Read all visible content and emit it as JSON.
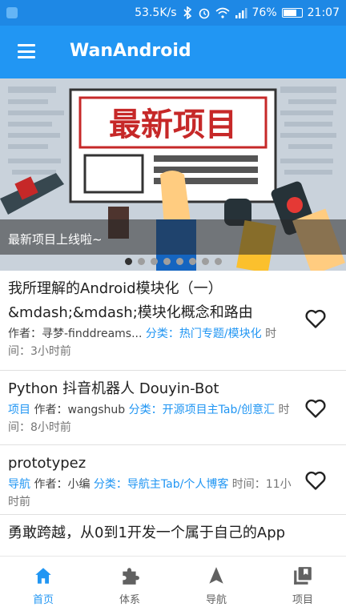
{
  "status_bar": {
    "net_speed": "53.5K/s",
    "battery": "76%",
    "battery_level": 0.76,
    "time": "21:07"
  },
  "toolbar": {
    "menu_icon": "menu-icon",
    "title": "WanAndroid"
  },
  "banner": {
    "image_text": "最新项目",
    "caption": "最新项目上线啦~",
    "dot_count": 8,
    "active_dot": 0
  },
  "articles": [
    {
      "title": "我所理解的Android模块化（一）&mdash;&mdash;模块化概念和路由",
      "author_label": "作者：",
      "author": "寻梦-finddreams...",
      "category_label": "分类：",
      "category": "热门专题/模块化",
      "time_label": "时间：",
      "time": "3小时前",
      "tag": ""
    },
    {
      "title": "Python 抖音机器人 Douyin-Bot",
      "tag": "项目",
      "author_label": "作者：",
      "author": "wangshub",
      "category_label": "分类：",
      "category": "开源项目主Tab/创意汇",
      "time_label": "时间：",
      "time": "8小时前"
    },
    {
      "title": "prototypez",
      "tag": "导航",
      "author_label": "作者：",
      "author": "小编",
      "category_label": "分类：",
      "category": "导航主Tab/个人博客",
      "time_label": "时间：",
      "time": "11小时前"
    },
    {
      "title": "勇敢跨越，从0到1开发一个属于自己的App"
    }
  ],
  "bottom_nav": [
    {
      "label": "首页",
      "icon": "home-icon",
      "active": true
    },
    {
      "label": "体系",
      "icon": "puzzle-icon",
      "active": false
    },
    {
      "label": "导航",
      "icon": "navigation-icon",
      "active": false
    },
    {
      "label": "项目",
      "icon": "library-icon",
      "active": false
    }
  ],
  "colors": {
    "primary": "#2196f3",
    "status_bar": "#1e88e5",
    "accent_text": "#2196f3"
  }
}
